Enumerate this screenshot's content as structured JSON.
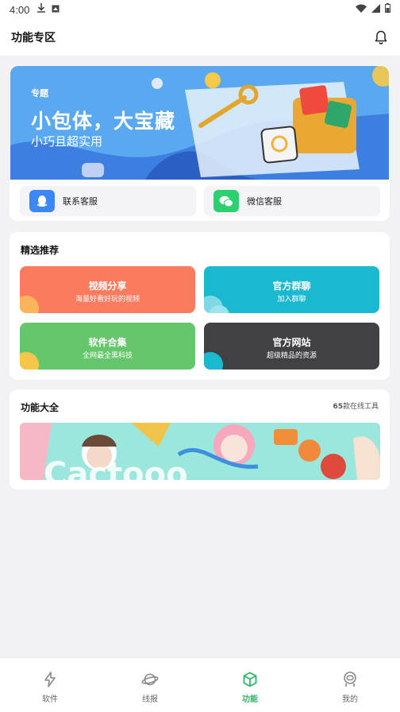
{
  "status_bar": {
    "time": "4:00"
  },
  "app_bar": {
    "title": "功能专区"
  },
  "banner": {
    "tag": "专题",
    "headline": "小包体，大宝藏",
    "subtitle": "小巧且超实用"
  },
  "services": [
    {
      "label": "联系客服",
      "icon": "qq-penguin-icon"
    },
    {
      "label": "微信客服",
      "icon": "wechat-icon"
    }
  ],
  "featured": {
    "title": "精选推荐",
    "tiles": [
      {
        "title": "视频分享",
        "subtitle": "海量好看好玩的视频",
        "color": "#fb7b5f"
      },
      {
        "title": "官方群聊",
        "subtitle": "加入群聊",
        "color": "#1ab9cf"
      },
      {
        "title": "软件合集",
        "subtitle": "全网最全黑科技",
        "color": "#66c66b"
      },
      {
        "title": "官方网站",
        "subtitle": "超级精品的资源",
        "color": "#414045"
      }
    ]
  },
  "tools": {
    "title": "功能大全",
    "count": "65",
    "count_suffix": "款在线工具"
  },
  "bottom_nav": [
    {
      "label": "软件",
      "icon": "lightning-icon",
      "active": false
    },
    {
      "label": "线报",
      "icon": "planet-icon",
      "active": false
    },
    {
      "label": "功能",
      "icon": "cube-icon",
      "active": true
    },
    {
      "label": "我的",
      "icon": "astronaut-icon",
      "active": false
    }
  ],
  "colors": {
    "accent": "#2fb36a",
    "banner_blue": "#5aa8f0"
  }
}
